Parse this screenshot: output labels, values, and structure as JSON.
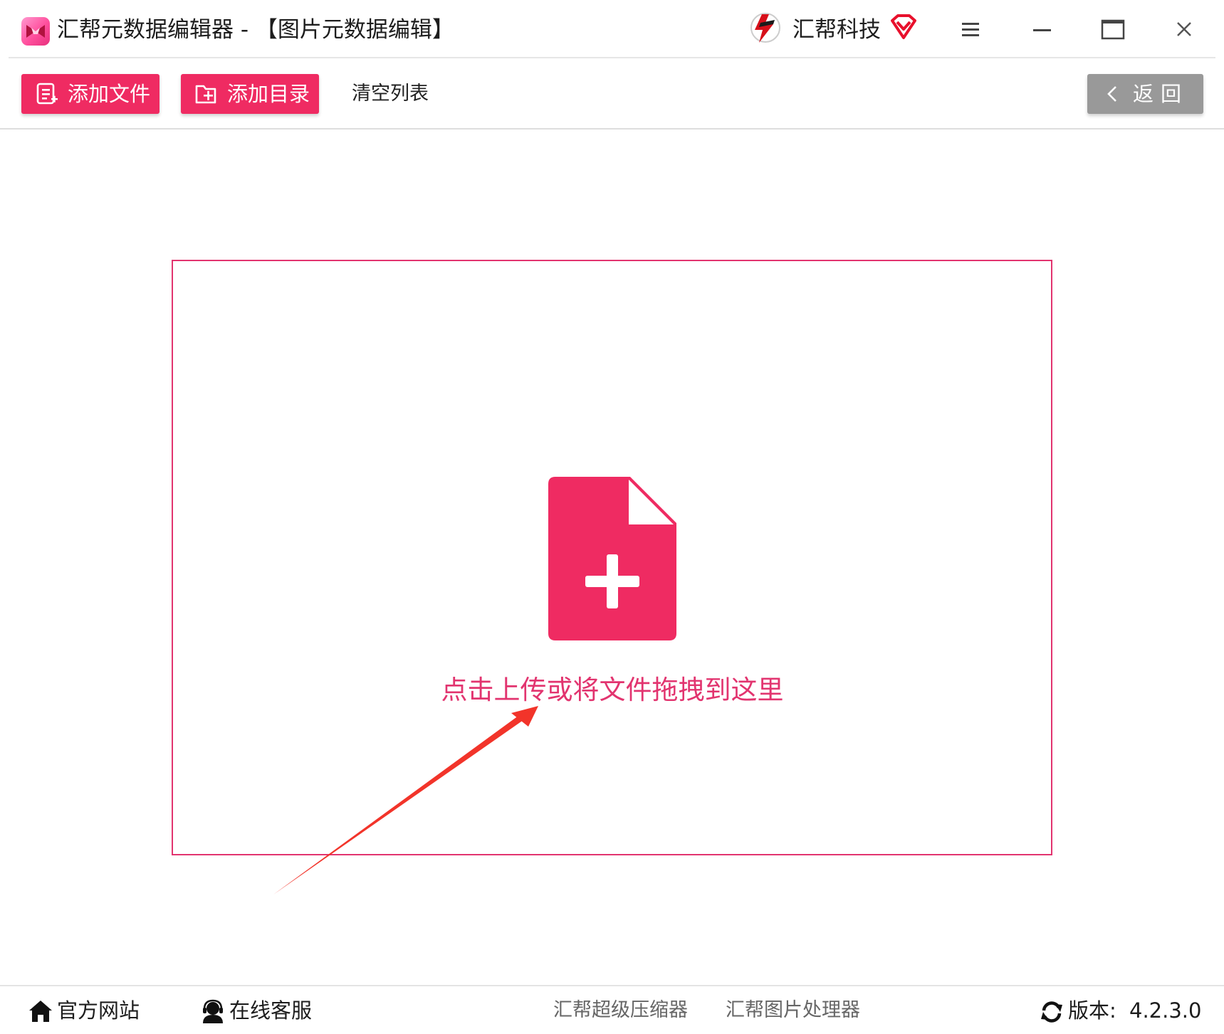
{
  "window": {
    "title": "汇帮元数据编辑器 - 【图片元数据编辑】",
    "brand": "汇帮科技",
    "icons": {
      "app": "app-logo-icon",
      "brand": "brand-logo-icon",
      "vip": "vip-diamond-icon",
      "menu": "hamburger-menu-icon",
      "minimize": "minimize-icon",
      "maximize": "maximize-icon",
      "close": "close-icon"
    }
  },
  "toolbar": {
    "add_file_label": "添加文件",
    "add_dir_label": "添加目录",
    "clear_label": "清空列表",
    "back_label": "返回"
  },
  "dropzone": {
    "hint": "点击上传或将文件拖拽到这里",
    "icon": "file-plus-icon"
  },
  "statusbar": {
    "website_label": "官方网站",
    "service_label": "在线客服",
    "products": [
      "汇帮超级压缩器",
      "汇帮图片处理器"
    ],
    "version_label": "版本:",
    "version_value": "4.2.3.0"
  },
  "colors": {
    "accent": "#ef2b62",
    "dropzone_border": "#e2346f",
    "hint_text": "#e2346f",
    "back_button": "#999999",
    "annotation_arrow": "#f2342a"
  }
}
